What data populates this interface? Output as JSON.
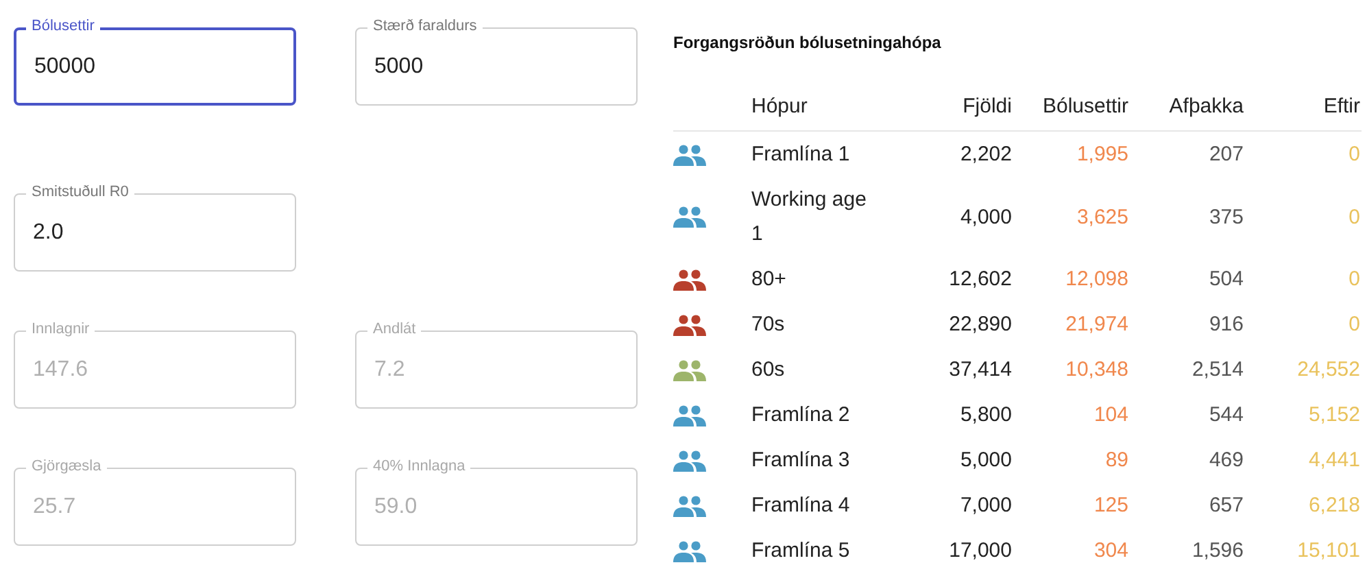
{
  "field_rows": [
    [
      {
        "label": "Bólusettir",
        "value": "50000",
        "focused": true,
        "disabled": false
      },
      {
        "label": "Stærð faraldurs",
        "value": "5000",
        "focused": false,
        "disabled": false
      }
    ],
    [
      {
        "label": "Smitstuðull R0",
        "value": "2.0",
        "focused": false,
        "disabled": false
      }
    ],
    [
      {
        "label": "Innlagnir",
        "value": "147.6",
        "focused": false,
        "disabled": true
      },
      {
        "label": "Andlát",
        "value": "7.2",
        "focused": false,
        "disabled": true
      }
    ],
    [
      {
        "label": "Gjörgæsla",
        "value": "25.7",
        "focused": false,
        "disabled": true
      },
      {
        "label": "40% Innlagna",
        "value": "59.0",
        "focused": false,
        "disabled": true
      }
    ]
  ],
  "table": {
    "title": "Forgangsröðun bólusetningahópa",
    "columns": [
      "Hópur",
      "Fjöldi",
      "Bólusettir",
      "Afþakka",
      "Eftir"
    ],
    "rows": [
      {
        "color": "#4a9cc7",
        "group": "Framlína 1",
        "count": "2,202",
        "vaccinated": "1,995",
        "declined": "207",
        "remaining": "0"
      },
      {
        "color": "#4a9cc7",
        "group": "Working age 1",
        "count": "4,000",
        "vaccinated": "3,625",
        "declined": "375",
        "remaining": "0"
      },
      {
        "color": "#b8402c",
        "group": "80+",
        "count": "12,602",
        "vaccinated": "12,098",
        "declined": "504",
        "remaining": "0"
      },
      {
        "color": "#b8402c",
        "group": "70s",
        "count": "22,890",
        "vaccinated": "21,974",
        "declined": "916",
        "remaining": "0"
      },
      {
        "color": "#9db56b",
        "group": "60s",
        "count": "37,414",
        "vaccinated": "10,348",
        "declined": "2,514",
        "remaining": "24,552"
      },
      {
        "color": "#4a9cc7",
        "group": "Framlína 2",
        "count": "5,800",
        "vaccinated": "104",
        "declined": "544",
        "remaining": "5,152"
      },
      {
        "color": "#4a9cc7",
        "group": "Framlína 3",
        "count": "5,000",
        "vaccinated": "89",
        "declined": "469",
        "remaining": "4,441"
      },
      {
        "color": "#4a9cc7",
        "group": "Framlína 4",
        "count": "7,000",
        "vaccinated": "125",
        "declined": "657",
        "remaining": "6,218"
      },
      {
        "color": "#4a9cc7",
        "group": "Framlína 5",
        "count": "17,000",
        "vaccinated": "304",
        "declined": "1,596",
        "remaining": "15,101"
      }
    ]
  }
}
